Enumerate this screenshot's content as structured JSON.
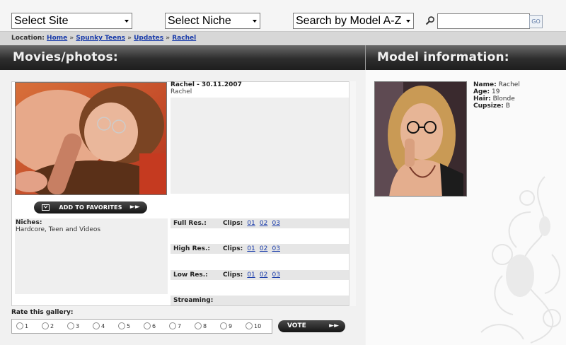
{
  "topbar": {
    "site_select": "Select Site",
    "niche_select": "Select Niche",
    "model_select": "Search by Model A-Z",
    "search_value": "",
    "go_label": "GO"
  },
  "breadcrumb": {
    "prefix": "Location:",
    "items": [
      "Home",
      "Spunky Teens",
      "Updates",
      "Rachel"
    ],
    "separator": "»"
  },
  "headers": {
    "left": "Movies/photos:",
    "right": "Model information:"
  },
  "gallery": {
    "title": "Rachel - 30.11.2007",
    "model_name": "Rachel",
    "favorites_label": "ADD TO FAVORITES",
    "arrows": "►►",
    "niches_label": "Niches:",
    "niches_value": "Hardcore, Teen and Videos",
    "clips_label": "Clips:",
    "resolutions": [
      {
        "label": "Full Res.:",
        "clips": [
          "01",
          "02",
          "03"
        ]
      },
      {
        "label": "High Res.:",
        "clips": [
          "01",
          "02",
          "03"
        ]
      },
      {
        "label": "Low Res.:",
        "clips": [
          "01",
          "02",
          "03"
        ]
      }
    ],
    "streaming_label": "Streaming:"
  },
  "rating": {
    "label": "Rate this gallery:",
    "options": [
      "1",
      "2",
      "3",
      "4",
      "5",
      "6",
      "7",
      "8",
      "9",
      "10"
    ],
    "vote_label": "VOTE"
  },
  "model_info": {
    "name_label": "Name:",
    "name": "Rachel",
    "age_label": "Age:",
    "age": "19",
    "hair_label": "Hair:",
    "hair": "Blonde",
    "cup_label": "Cupsize:",
    "cup": "B"
  },
  "colors": {
    "header_dark": "#1e1e1e",
    "link_blue": "#1a3caa",
    "row_grey": "#e6e6e6"
  }
}
